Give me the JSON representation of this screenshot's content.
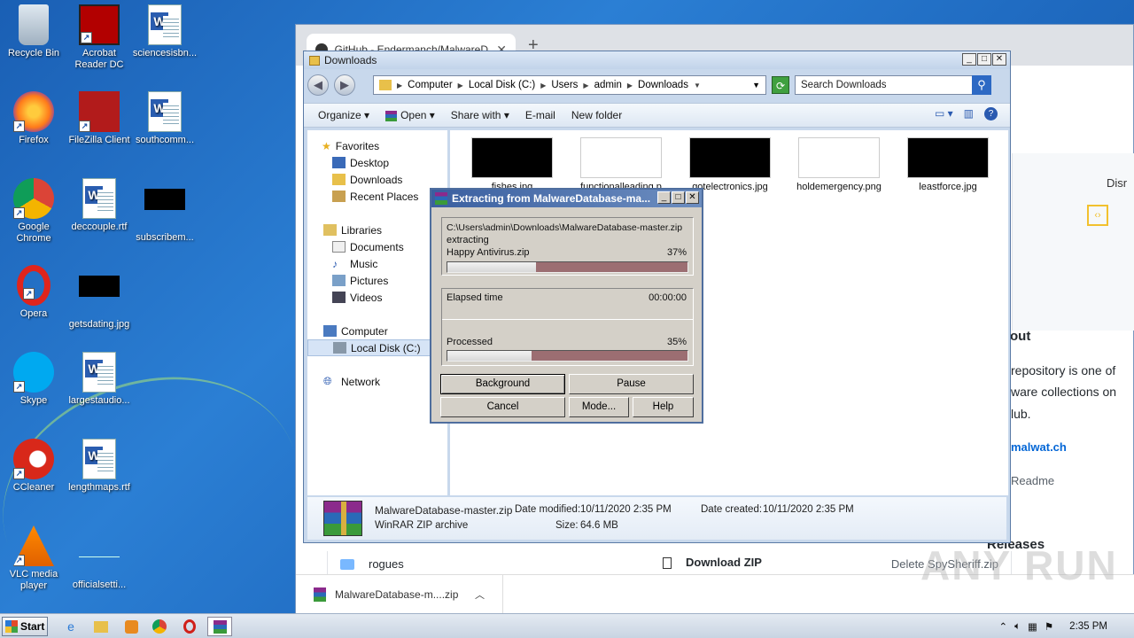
{
  "desktop": {
    "icons": [
      {
        "label": "Recycle Bin",
        "icon": "recycle-bin-icon"
      },
      {
        "label": "Acrobat Reader DC",
        "icon": "acrobat-icon"
      },
      {
        "label": "sciencesisbn...",
        "icon": "word-doc-icon"
      },
      {
        "label": "Firefox",
        "icon": "firefox-icon"
      },
      {
        "label": "FileZilla Client",
        "icon": "filezilla-icon"
      },
      {
        "label": "southcomm...",
        "icon": "word-doc-icon"
      },
      {
        "label": "Google Chrome",
        "icon": "chrome-icon"
      },
      {
        "label": "deccouple.rtf",
        "icon": "word-doc-icon"
      },
      {
        "label": "subscribem...",
        "icon": "image-thumb-icon"
      },
      {
        "label": "Opera",
        "icon": "opera-icon"
      },
      {
        "label": "getsdating.jpg",
        "icon": "image-thumb-icon"
      },
      {
        "label": "Skype",
        "icon": "skype-icon"
      },
      {
        "label": "largestaudio...",
        "icon": "word-doc-icon"
      },
      {
        "label": "CCleaner",
        "icon": "ccleaner-icon"
      },
      {
        "label": "lengthmaps.rtf",
        "icon": "word-doc-icon"
      },
      {
        "label": "VLC media player",
        "icon": "vlc-icon"
      },
      {
        "label": "officialsetti...",
        "icon": "image-thumb-icon"
      }
    ]
  },
  "chrome": {
    "tab_title": "GitHub - Endermanch/MalwareDatab",
    "about_heading": "out",
    "about_lines": [
      "repository is one of",
      "ware collections on",
      "lub."
    ],
    "link_text": "malwat.ch",
    "readme": "Readme",
    "releases": "Releases",
    "disc_text": "Disr",
    "row_folder": "rogues",
    "row_commit": "Delete SpySheriff.zip",
    "download_zip": "Download ZIP",
    "download_shelf_file": "MalwareDatabase-m....zip",
    "watermark": "ANY RUN"
  },
  "explorer": {
    "title": "Downloads",
    "breadcrumb": [
      "Computer",
      "Local Disk (C:)",
      "Users",
      "admin",
      "Downloads"
    ],
    "search_placeholder": "Search Downloads",
    "toolbar": {
      "organize": "Organize",
      "open": "Open",
      "share_with": "Share with",
      "email": "E-mail",
      "new_folder": "New folder"
    },
    "nav": {
      "favorites": "Favorites",
      "desktop": "Desktop",
      "downloads": "Downloads",
      "recent_places": "Recent Places",
      "libraries": "Libraries",
      "documents": "Documents",
      "music": "Music",
      "pictures": "Pictures",
      "videos": "Videos",
      "computer": "Computer",
      "local_disk": "Local Disk (C:)",
      "network": "Network"
    },
    "files": [
      {
        "name": "fishes.jpg",
        "thumb": "#000000"
      },
      {
        "name": "functionalleading.p",
        "thumb": "#ffffff"
      },
      {
        "name": "gotelectronics.jpg",
        "thumb": "#000000"
      },
      {
        "name": "holdemergency.png",
        "thumb": "#ffffff"
      },
      {
        "name": "leastforce.jpg",
        "thumb": "#000000"
      }
    ],
    "details": {
      "filename": "MalwareDatabase-master.zip",
      "type": "WinRAR ZIP archive",
      "date_modified_label": "Date modified:",
      "date_modified": "10/11/2020 2:35 PM",
      "date_created_label": "Date created:",
      "date_created": "10/11/2020 2:35 PM",
      "size_label": "Size:",
      "size": "64.6 MB"
    }
  },
  "rar": {
    "title": "Extracting from MalwareDatabase-ma...",
    "path": "C:\\Users\\admin\\Downloads\\MalwareDatabase-master.zip",
    "action": "extracting",
    "current_file": "Happy Antivirus.zip",
    "file_percent_text": "37%",
    "file_progress": 0.37,
    "elapsed_label": "Elapsed time",
    "elapsed_value": "00:00:00",
    "processed_label": "Processed",
    "processed_percent_text": "35%",
    "processed_progress": 0.35,
    "buttons": {
      "background": "Background",
      "pause": "Pause",
      "cancel": "Cancel",
      "mode": "Mode...",
      "help": "Help"
    }
  },
  "taskbar": {
    "start": "Start",
    "time": "2:35 PM"
  }
}
